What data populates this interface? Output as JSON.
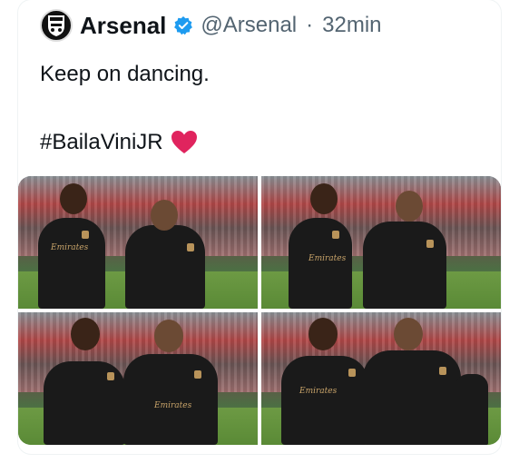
{
  "tweet": {
    "display_name": "Arsenal",
    "handle": "@Arsenal",
    "separator": "·",
    "time": "32min",
    "text": "Keep on dancing.",
    "hashtag": "#BailaViniJR",
    "avatar_icon": "arsenal-crest-icon",
    "verified_icon": "verified-badge-icon",
    "heart_icon": "red-heart-icon",
    "colors": {
      "verified": "#1d9bf0",
      "heart": "#e0245e",
      "muted": "#536471"
    }
  },
  "media": {
    "photos": [
      {
        "sponsor": "Emirates"
      },
      {
        "sponsor": "Emirates"
      },
      {
        "sponsor": "Emirates"
      },
      {
        "sponsor": "Emirates"
      }
    ]
  }
}
